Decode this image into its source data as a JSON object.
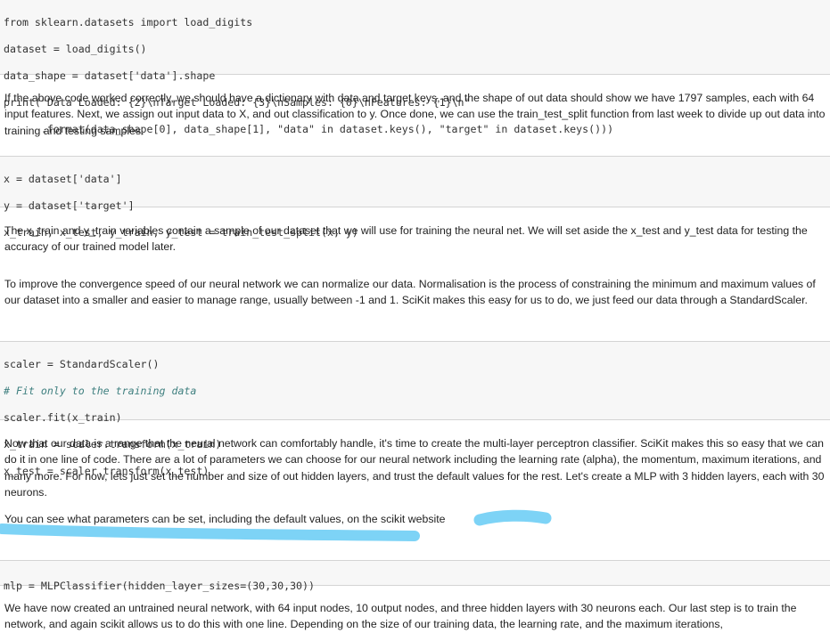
{
  "cells": {
    "code1": {
      "l1": "from sklearn.datasets import load_digits",
      "l2": "dataset = load_digits()",
      "l3": "data_shape = dataset['data'].shape",
      "l4": "print(\"Data Loaded: {2}\\nTarget Loaded: {3}\\nSamples: {0}\\nFeatures: {1}\\n\"",
      "l5": "      .format(data_shape[0], data_shape[1], \"data\" in dataset.keys(), \"target\" in dataset.keys()))"
    },
    "md1": "If the above code worked correctly, we should have a dictionary with data and target keys, and the shape of out data should show we have 1797 samples, each with 64 input features. Next, we assign out input data to X, and out classification to y. Once done, we can use the train_test_split function from last week to divide up out data into training and testing samples.",
    "code2": {
      "l1": "x = dataset['data']",
      "l2": "y = dataset['target']",
      "l3": "x_train, x_test, y_train, y_test = train_test_split(x, y)"
    },
    "md2": "The x_train and y_train variables contain a sample of our dataset that we will use for training the neural net. We will set aside the x_test and y_test data for testing the accuracy of our trained model later.",
    "md3": "To improve the convergence speed of our neural network we can normalize our data. Normalisation is the process of constraining the minimum and maximum values of our dataset into a smaller and easier to manage range, usually between -1 and 1. SciKit makes this easy for us to do, we just feed our data through a StandardScaler.",
    "code3": {
      "l1": "scaler = StandardScaler()",
      "l2": "# Fit only to the training data",
      "l3": "scaler.fit(x_train)",
      "l4": "x_train = scaler.transform(x_train)",
      "l5": "x_test = scaler.transform(x_test)"
    },
    "md4": "Now that our data is a range that the neural network can comfortably handle, it's time to create the multi-layer perceptron classifier. SciKit makes this so easy that we can do it in one line of code. There are a lot of parameters we can choose for our neural network including the learning rate (alpha), the momentum, maximum iterations, and many more. For now, lets just set the number and size of out hidden layers, and trust the default values for the rest. Let's create a MLP with 3 hidden layers, each with 30 neurons.",
    "md5": "You can see what parameters can be set, including the default values, on the scikit website",
    "code4": {
      "l1": "mlp = MLPClassifier(hidden_layer_sizes=(30,30,30))"
    },
    "md6": "We have now created an untrained neural network, with 64 input nodes, 10 output nodes, and three hidden layers with 30 neurons each. Our last step is to train the network, and again scikit allows us to do this with one line. Depending on the size of our training data, the learning rate, and the maximum iterations,"
  },
  "colors": {
    "scribble": "#7dd3f6",
    "code_bg": "#f7f7f7"
  }
}
